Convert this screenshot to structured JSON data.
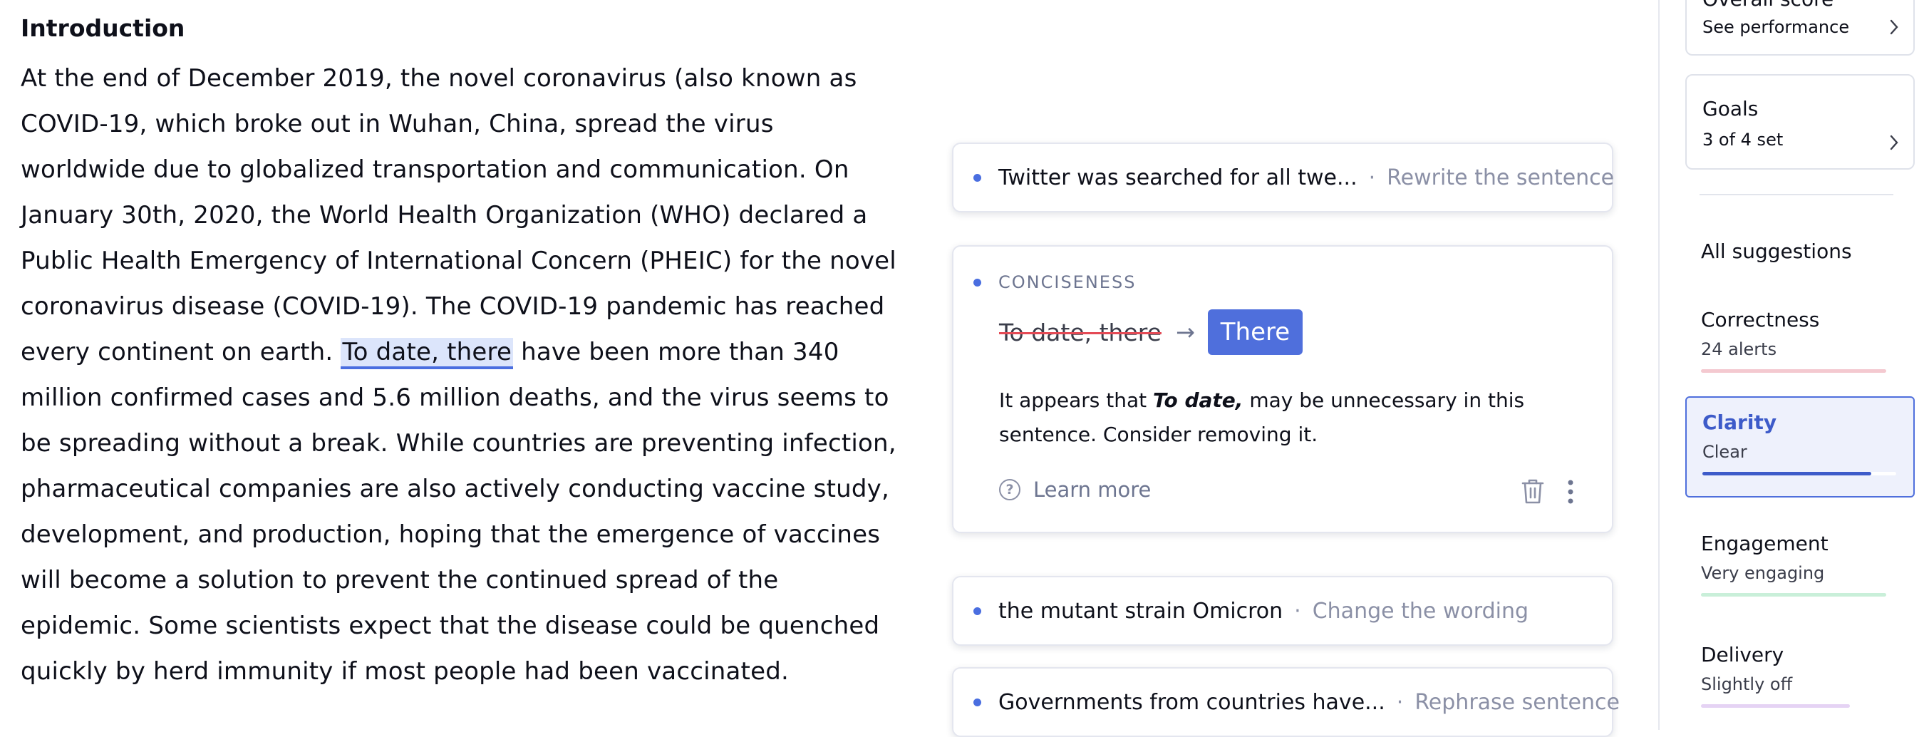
{
  "document": {
    "heading": "Introduction",
    "text_before": "At the end of December 2019, the novel coronavirus (also known as COVID-19, which broke out in Wuhan, China, spread the virus worldwide due to globalized transportation and communication. On January 30th, 2020, the World Health Organization (WHO) declared a Public Health Emergency of International Concern (PHEIC) for the novel coronavirus disease (COVID-19). The COVID-19 pandemic has reached every continent on earth. ",
    "highlight": "To date, there",
    "text_after": " have been more than 340 million confirmed cases and 5.6 million deaths, and the virus seems to be spreading without a break. While countries are preventing infection, pharmaceutical companies are also actively conducting vaccine study, development, and production, hoping that the emergence of vaccines will become a solution to prevent the continued spread of the epidemic. Some scientists expect that the disease could be quenched quickly by herd immunity if most people had been vaccinated."
  },
  "suggestions": {
    "card1": {
      "snippet": "Twitter was searched for all twe...",
      "action": "Rewrite the sentence"
    },
    "expanded": {
      "category": "CONCISENESS",
      "original": "To date, there",
      "replacement": "There",
      "explain_before": "It appears that ",
      "explain_bold": "To date,",
      "explain_after": " may be unnecessary in this sentence. Consider removing it.",
      "learn_more": "Learn more"
    },
    "card3": {
      "snippet": "the mutant strain Omicron",
      "action": "Change the wording"
    },
    "card4": {
      "snippet": "Governments from countries have...",
      "action": "Rephrase sentence"
    },
    "separator": "·"
  },
  "sidebar": {
    "overall": {
      "title": "Overall score",
      "sub": "See performance"
    },
    "goals": {
      "title": "Goals",
      "sub": "3 of 4 set"
    },
    "all_suggestions": "All suggestions",
    "metrics": [
      {
        "name": "Correctness",
        "status": "24 alerts",
        "color": "#f4c9d0",
        "progress": 1.0
      },
      {
        "name": "Clarity",
        "status": "Clear",
        "color": "#3d5bc9",
        "progress": 0.87
      },
      {
        "name": "Engagement",
        "status": "Very engaging",
        "color": "#c9efd9",
        "progress": 1.0
      },
      {
        "name": "Delivery",
        "status": "Slightly off",
        "color": "#e5d3f4",
        "progress": 0.78
      }
    ]
  }
}
